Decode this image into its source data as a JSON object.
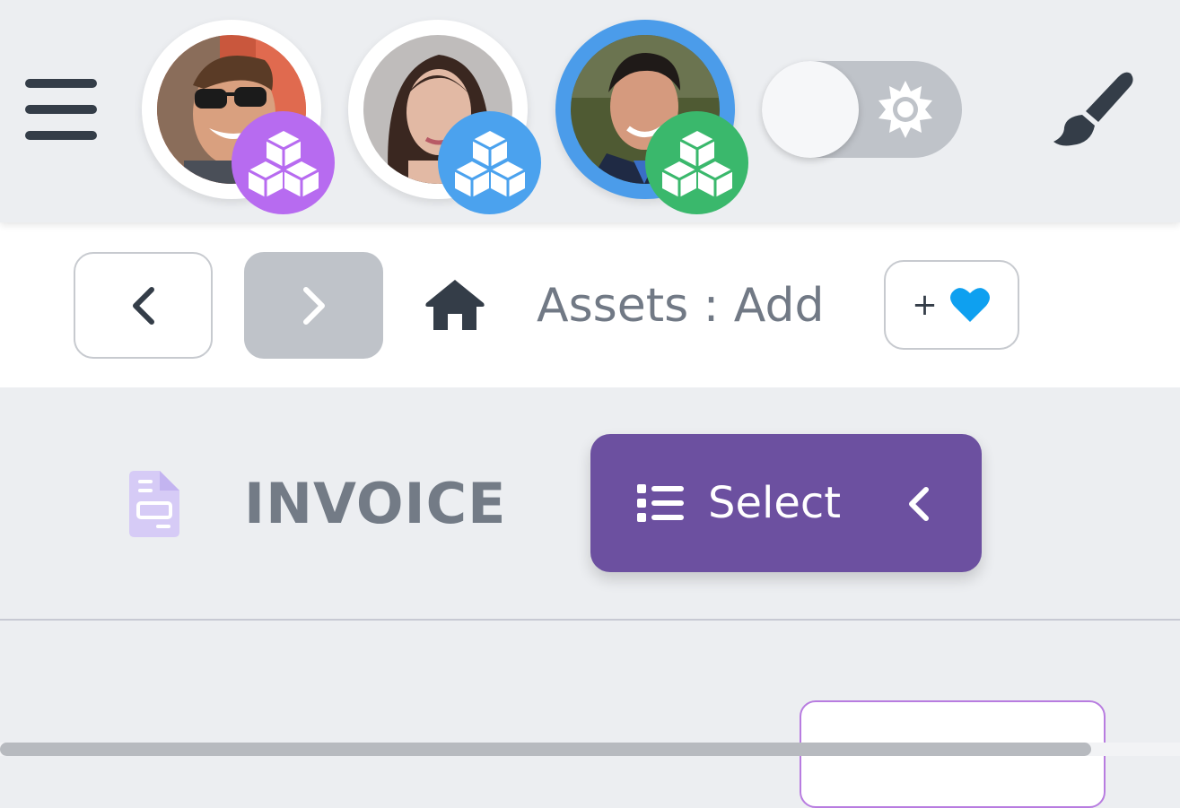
{
  "topbar": {
    "menu_icon": "hamburger-icon",
    "avatars": [
      {
        "name": "user-avatar-1",
        "badge_icon": "cubes-icon",
        "badge_color": "#b76bf0",
        "active": false
      },
      {
        "name": "user-avatar-2",
        "badge_icon": "cubes-icon",
        "badge_color": "#4ba2ee",
        "active": false
      },
      {
        "name": "user-avatar-3",
        "badge_icon": "cubes-icon",
        "badge_color": "#3ab86c",
        "active": true,
        "ring_color": "#4b9cea"
      }
    ],
    "theme_toggle": {
      "icon": "sun-icon",
      "checked": false
    },
    "paint_icon": "paintbrush-icon"
  },
  "breadcrumb": {
    "prev_icon": "chevron-left-icon",
    "next_icon": "chevron-right-icon",
    "home_icon": "home-icon",
    "path": "Assets : Add",
    "fav_plus": "+",
    "fav_icon": "heart-icon",
    "fav_color": "#0ea0f0"
  },
  "header": {
    "doc_icon": "document-icon",
    "title": "INVOICE",
    "select": {
      "label": "Select",
      "icon": "list-icon",
      "chevron": "chevron-left-icon",
      "color": "#6c50a0"
    }
  }
}
